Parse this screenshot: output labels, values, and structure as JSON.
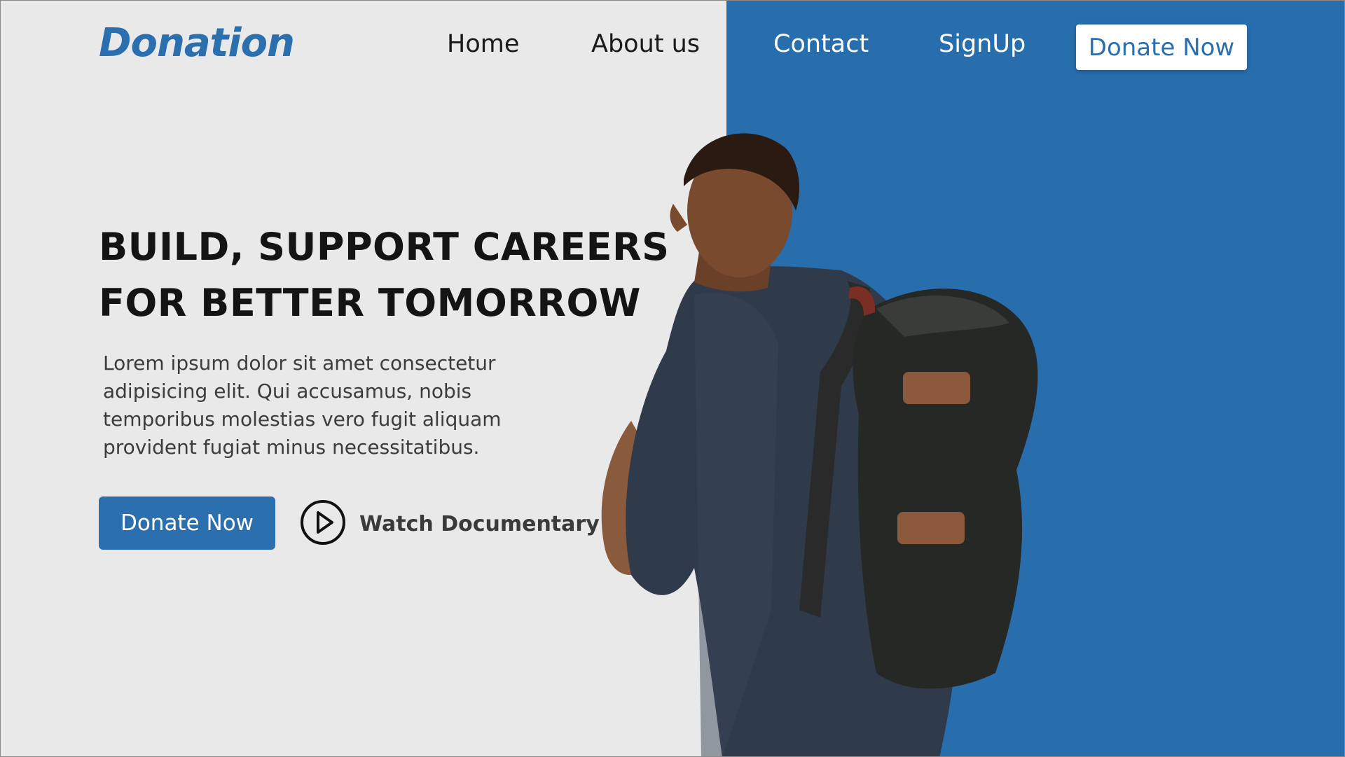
{
  "brand": {
    "logo_text": "Donation"
  },
  "nav": {
    "items": [
      {
        "label": "Home"
      },
      {
        "label": "About us"
      },
      {
        "label": "Contact"
      },
      {
        "label": "SignUp"
      }
    ],
    "cta_label": "Donate Now"
  },
  "hero": {
    "headline_line1": "BUILD, SUPPORT CAREERS",
    "headline_line2": "FOR BETTER TOMORROW",
    "body": "Lorem ipsum dolor sit amet consectetur adipisicing elit. Qui accusamus, nobis temporibus molestias vero fugit aliquam provident fugiat minus necessitatibus.",
    "primary_button_label": "Donate Now",
    "secondary_link_label": "Watch Documentary",
    "secondary_icon": "play-circle-icon"
  },
  "colors": {
    "brand_blue": "#286ead",
    "background_left": "#e9e9ea",
    "text_dark": "#141414"
  }
}
